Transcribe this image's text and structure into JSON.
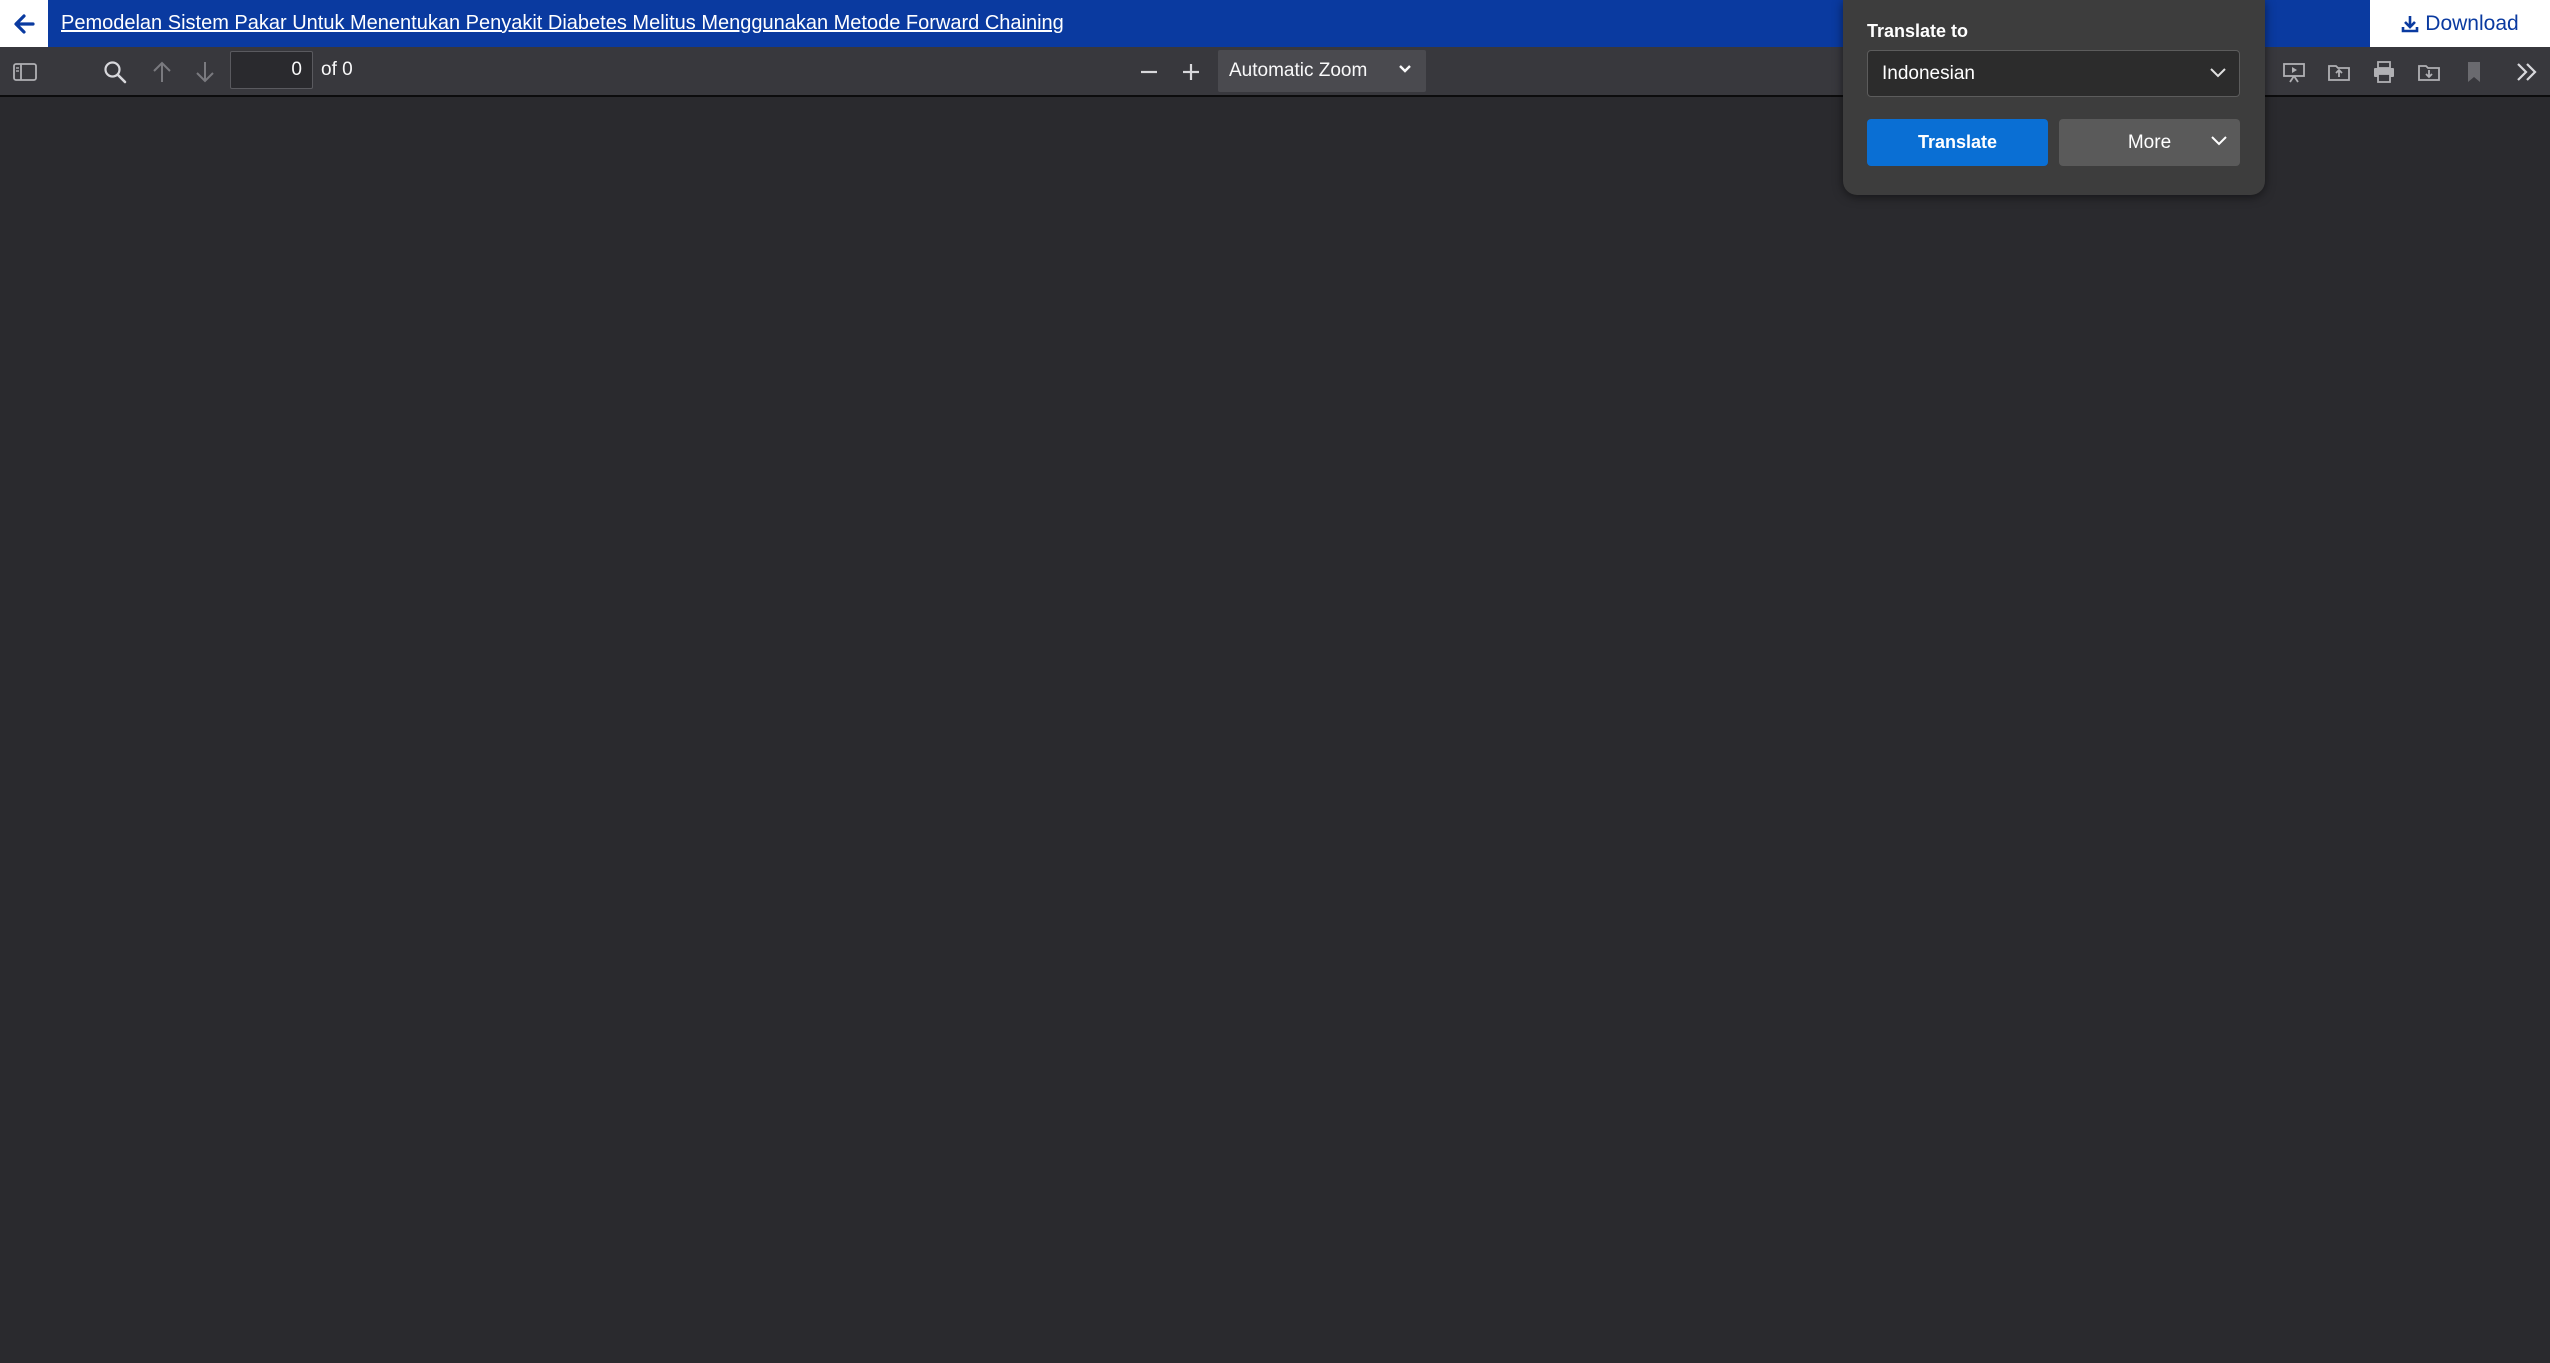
{
  "header": {
    "title": "Pemodelan Sistem Pakar Untuk Menentukan Penyakit Diabetes Melitus Menggunakan Metode Forward Chaining",
    "download_label": "Download"
  },
  "toolbar": {
    "page_value": "0",
    "page_of": "of 0",
    "zoom_label": "Automatic Zoom"
  },
  "translate_popup": {
    "label": "Translate to",
    "language": "Indonesian",
    "translate_label": "Translate",
    "more_label": "More"
  },
  "colors": {
    "titlebar": "#0a3aa0",
    "toolbar": "#38383d",
    "viewer": "#2a2a2e",
    "translate_button": "#0a6fd4"
  },
  "icons": {
    "back": "arrow-left-icon",
    "download": "download-icon",
    "sidebar": "sidebar-toggle-icon",
    "search": "search-icon",
    "prev": "arrow-up-icon",
    "next": "arrow-down-icon",
    "zoom_out": "minus-icon",
    "zoom_in": "plus-icon",
    "presentation": "presentation-icon",
    "open": "open-file-icon",
    "print": "print-icon",
    "save": "save-icon",
    "bookmark": "bookmark-icon",
    "tools": "double-chevron-right-icon"
  }
}
